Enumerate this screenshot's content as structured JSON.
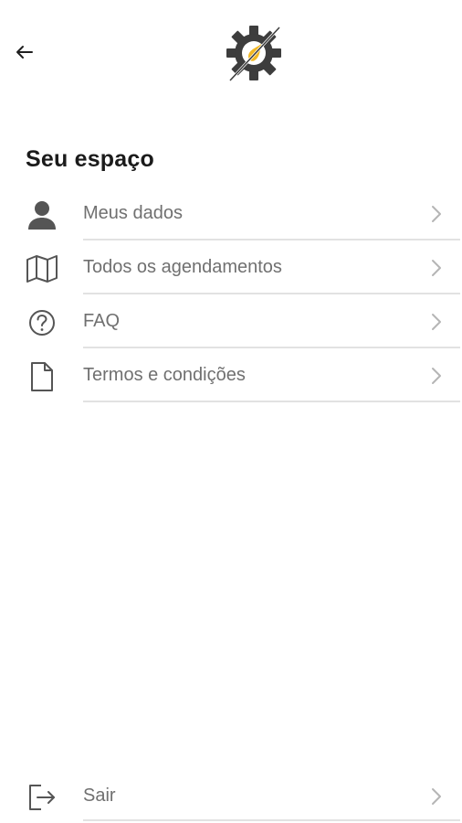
{
  "header": {
    "back_icon": "arrow-left-icon",
    "logo_icon": "gear-with-drop-logo",
    "colors": {
      "logo_gear": "#3d3d3d",
      "logo_accent": "#f2b824"
    }
  },
  "section": {
    "title": "Seu espaço"
  },
  "menu": {
    "items": [
      {
        "label": "Meus dados",
        "icon": "user-icon"
      },
      {
        "label": "Todos os agendamentos",
        "icon": "map-icon"
      },
      {
        "label": "FAQ",
        "icon": "help-circle-icon"
      },
      {
        "label": "Termos e condições",
        "icon": "document-icon"
      }
    ],
    "chevron_icon": "chevron-right-icon"
  },
  "logout": {
    "label": "Sair",
    "icon": "logout-icon"
  },
  "colors": {
    "label": "#707070",
    "divider": "#e2e2e2",
    "icon": "#555555",
    "title": "#1b1b1b"
  }
}
